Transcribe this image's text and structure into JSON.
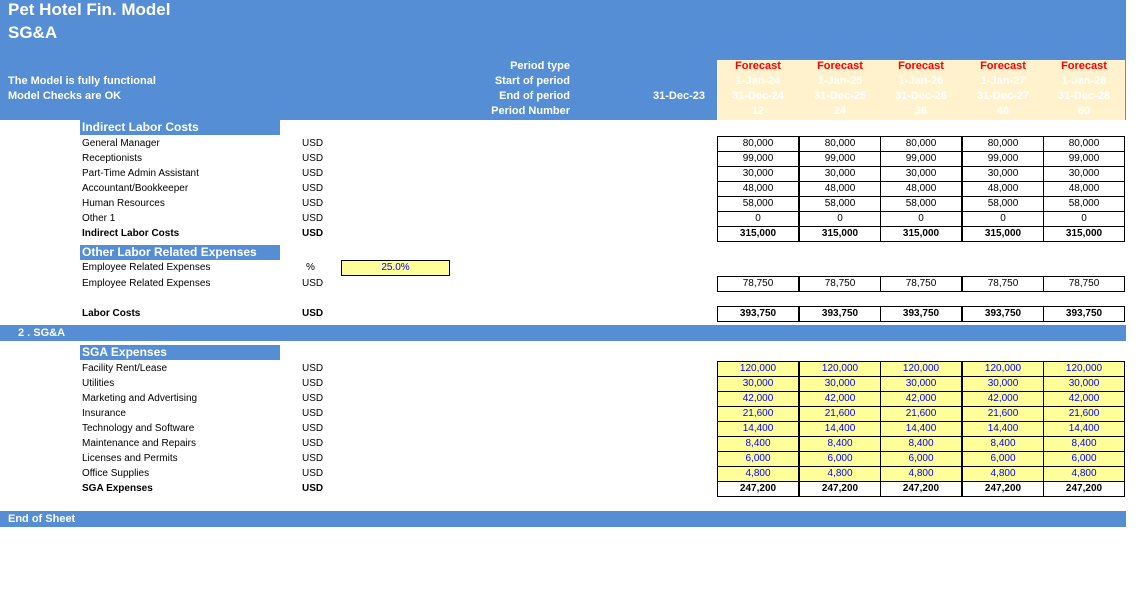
{
  "header": {
    "title": "Pet Hotel Fin. Model",
    "subtitle": "SG&A",
    "status_1": "The Model is fully functional",
    "status_2": "Model Checks are OK",
    "row_labels": [
      "Period type",
      "Start of period",
      "End of period",
      "Period Number"
    ],
    "prior_end": "31-Dec-23",
    "periods": [
      {
        "type": "Forecast",
        "start": "1-Jan-24",
        "end": "31-Dec-24",
        "number": "12"
      },
      {
        "type": "Forecast",
        "start": "1-Jan-25",
        "end": "31-Dec-25",
        "number": "24"
      },
      {
        "type": "Forecast",
        "start": "1-Jan-26",
        "end": "31-Dec-26",
        "number": "36"
      },
      {
        "type": "Forecast",
        "start": "1-Jan-27",
        "end": "31-Dec-27",
        "number": "48"
      },
      {
        "type": "Forecast",
        "start": "1-Jan-28",
        "end": "31-Dec-28",
        "number": "60"
      }
    ]
  },
  "indirect": {
    "band": "Indirect Labor Costs",
    "rows": [
      {
        "label": "General Manager",
        "unit": "USD",
        "values": [
          "80,000",
          "80,000",
          "80,000",
          "80,000",
          "80,000"
        ]
      },
      {
        "label": "Receptionists",
        "unit": "USD",
        "values": [
          "99,000",
          "99,000",
          "99,000",
          "99,000",
          "99,000"
        ]
      },
      {
        "label": "Part-Time Admin Assistant",
        "unit": "USD",
        "values": [
          "30,000",
          "30,000",
          "30,000",
          "30,000",
          "30,000"
        ]
      },
      {
        "label": "Accountant/Bookkeeper",
        "unit": "USD",
        "values": [
          "48,000",
          "48,000",
          "48,000",
          "48,000",
          "48,000"
        ]
      },
      {
        "label": "Human Resources",
        "unit": "USD",
        "values": [
          "58,000",
          "58,000",
          "58,000",
          "58,000",
          "58,000"
        ]
      },
      {
        "label": "Other 1",
        "unit": "USD",
        "values": [
          "0",
          "0",
          "0",
          "0",
          "0"
        ]
      }
    ],
    "total": {
      "label": "Indirect Labor Costs",
      "unit": "USD",
      "values": [
        "315,000",
        "315,000",
        "315,000",
        "315,000",
        "315,000"
      ]
    }
  },
  "other": {
    "band": "Other Labor Related Expenses",
    "pct_label": "Employee Related Expenses",
    "pct_unit": "%",
    "pct_value": "25.0%",
    "row": {
      "label": "Employee Related Expenses",
      "unit": "USD",
      "values": [
        "78,750",
        "78,750",
        "78,750",
        "78,750",
        "78,750"
      ]
    }
  },
  "labor": {
    "label": "Labor Costs",
    "unit": "USD",
    "values": [
      "393,750",
      "393,750",
      "393,750",
      "393,750",
      "393,750"
    ]
  },
  "section2": "2 . SG&A",
  "sga": {
    "band": "SGA Expenses",
    "rows": [
      {
        "label": "Facility Rent/Lease",
        "unit": "USD",
        "values": [
          "120,000",
          "120,000",
          "120,000",
          "120,000",
          "120,000"
        ]
      },
      {
        "label": "Utilities",
        "unit": "USD",
        "values": [
          "30,000",
          "30,000",
          "30,000",
          "30,000",
          "30,000"
        ]
      },
      {
        "label": "Marketing and Advertising",
        "unit": "USD",
        "values": [
          "42,000",
          "42,000",
          "42,000",
          "42,000",
          "42,000"
        ]
      },
      {
        "label": "Insurance",
        "unit": "USD",
        "values": [
          "21,600",
          "21,600",
          "21,600",
          "21,600",
          "21,600"
        ]
      },
      {
        "label": "Technology and Software",
        "unit": "USD",
        "values": [
          "14,400",
          "14,400",
          "14,400",
          "14,400",
          "14,400"
        ]
      },
      {
        "label": "Maintenance and Repairs",
        "unit": "USD",
        "values": [
          "8,400",
          "8,400",
          "8,400",
          "8,400",
          "8,400"
        ]
      },
      {
        "label": "Licenses and Permits",
        "unit": "USD",
        "values": [
          "6,000",
          "6,000",
          "6,000",
          "6,000",
          "6,000"
        ]
      },
      {
        "label": "Office Supplies",
        "unit": "USD",
        "values": [
          "4,800",
          "4,800",
          "4,800",
          "4,800",
          "4,800"
        ]
      }
    ],
    "total": {
      "label": "SGA Expenses",
      "unit": "USD",
      "values": [
        "247,200",
        "247,200",
        "247,200",
        "247,200",
        "247,200"
      ]
    }
  },
  "footer": "End of Sheet",
  "colors": {
    "header_blue": "#558ed5",
    "forecast_red": "#ff0000",
    "input_yellow": "#ffff99",
    "input_blue": "#0000ff",
    "forecast_fill": "#fff2cc"
  }
}
